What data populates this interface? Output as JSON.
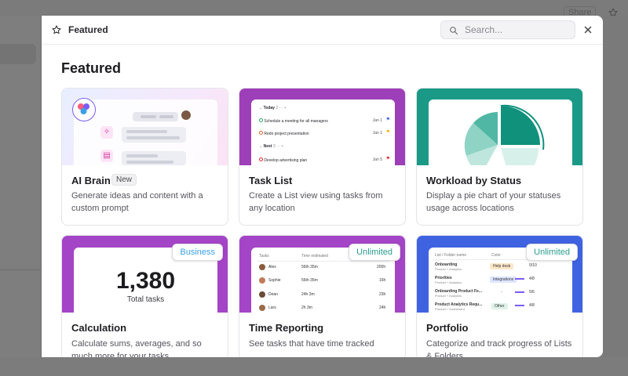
{
  "background": {
    "share_label": "Share"
  },
  "header": {
    "title": "Featured",
    "search_placeholder": "Search...",
    "close_icon": "close-icon",
    "star_icon": "star-icon"
  },
  "section_title": "Featured",
  "cards": [
    {
      "name": "AI Brain",
      "badge": "New",
      "description": "Generate ideas and content with a custom prompt",
      "thumb_color": "#f6e7fb"
    },
    {
      "name": "Task List",
      "description": "Create a List view using tasks from any location",
      "thumb_color": "#9d3fb8",
      "preview": {
        "group1": "Today",
        "group1_count": "2",
        "group2": "Next",
        "group2_count": "3",
        "tasks": [
          {
            "title": "Schedule a meeting for all managers",
            "date": "Jan 1"
          },
          {
            "title": "Redo project presentation",
            "date": "Jan 1"
          },
          {
            "title": "Develop advertising plan",
            "date": "Jan 5"
          }
        ]
      }
    },
    {
      "name": "Workload by Status",
      "description": "Display a pie chart of your statuses usage across locations",
      "thumb_color": "#1a9a86"
    },
    {
      "name": "Calculation",
      "plan": "Business",
      "description": "Calculate sums, averages, and so much more for your tasks",
      "thumb_color": "#a444c6",
      "preview": {
        "value": "1,380",
        "caption": "Total tasks"
      }
    },
    {
      "name": "Time Reporting",
      "plan": "Unlimited",
      "description": "See tasks that have time tracked",
      "thumb_color": "#a444c6",
      "preview": {
        "col1": "Tasks",
        "col2": "Time estimated",
        "rows": [
          {
            "name": "Alex",
            "time": "56th 35m",
            "total": "200h"
          },
          {
            "name": "Sophie",
            "time": "56th 35m",
            "total": "16h"
          },
          {
            "name": "Dean",
            "time": "24h 3m",
            "total": "23h"
          },
          {
            "name": "Lars",
            "time": "2h 3m",
            "total": "24h"
          }
        ]
      }
    },
    {
      "name": "Portfolio",
      "plan": "Unlimited",
      "description": "Categorize and track progress of Lists & Folders",
      "thumb_color": "#3f63e0",
      "preview": {
        "col1": "List / Folder name",
        "col2": "Color",
        "rows": [
          {
            "name": "Onboarding",
            "sub": "Product + Analytics",
            "tag": "Help desk",
            "tag_color": "#fde7c9",
            "prog": "0/10"
          },
          {
            "name": "Priorities",
            "sub": "Product + Analytics",
            "tag": "Integrations",
            "tag_color": "#dde6ff",
            "prog": "4/8"
          },
          {
            "name": "Onboarding Product Fe...",
            "sub": "Product + Analytics",
            "tag": "-",
            "tag_color": "#ffffff",
            "prog": "5/6"
          },
          {
            "name": "Product Analytics Requ...",
            "sub": "Product + Dashboard",
            "tag": "Other",
            "tag_color": "#dff2ea",
            "prog": "4/8"
          }
        ]
      }
    }
  ],
  "colors": {
    "accent_business": "#3aa0e8",
    "accent_unlimited": "#2a9d8f"
  }
}
